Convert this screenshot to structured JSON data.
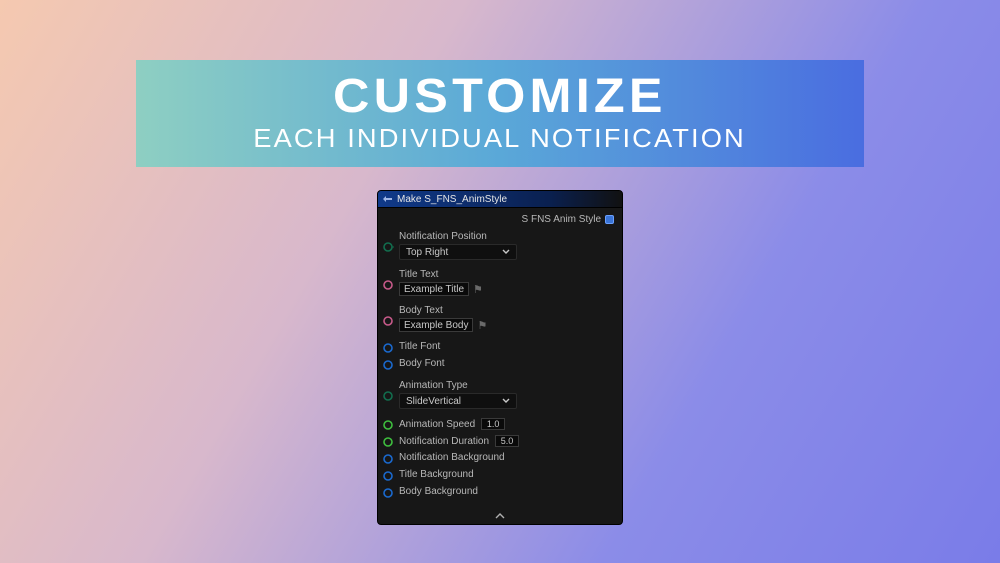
{
  "banner": {
    "title": "CUSTOMIZE",
    "subtitle": "EACH INDIVIDUAL NOTIFICATION"
  },
  "node": {
    "header": "Make S_FNS_AnimStyle",
    "output_label": "S FNS Anim Style",
    "pins": {
      "notification_position": {
        "label": "Notification Position",
        "value": "Top Right"
      },
      "title_text": {
        "label": "Title Text",
        "value": "Example Title"
      },
      "body_text": {
        "label": "Body Text",
        "value": "Example Body"
      },
      "title_font": {
        "label": "Title Font"
      },
      "body_font": {
        "label": "Body Font"
      },
      "animation_type": {
        "label": "Animation Type",
        "value": "SlideVertical"
      },
      "animation_speed": {
        "label": "Animation Speed",
        "value": "1.0"
      },
      "notification_duration": {
        "label": "Notification Duration",
        "value": "5.0"
      },
      "notification_background": {
        "label": "Notification Background"
      },
      "title_background": {
        "label": "Title Background"
      },
      "body_background": {
        "label": "Body Background"
      }
    }
  },
  "colors": {
    "pin_enum": "#126e4e",
    "pin_text": "#c85a8a",
    "pin_struct": "#1a6ad0",
    "pin_float": "#3fbf3f"
  }
}
